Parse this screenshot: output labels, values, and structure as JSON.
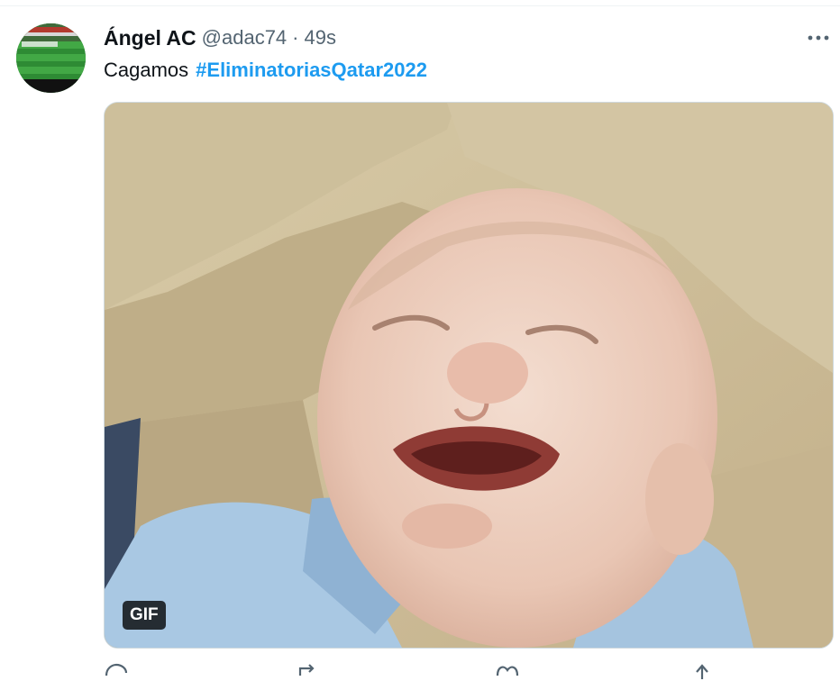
{
  "tweet": {
    "display_name": "Ángel AC",
    "handle": "@adac74",
    "separator": "·",
    "timestamp": "49s",
    "text": "Cagamos",
    "hashtag": "#EliminatoriasQatar2022"
  },
  "media": {
    "badge": "GIF",
    "description_icon": "crying-baby-gif"
  },
  "actions": [
    "reply-icon",
    "retweet-icon",
    "like-icon",
    "share-icon"
  ],
  "colors": {
    "link": "#1d9bf0",
    "secondary_text": "#536471",
    "primary_text": "#0f1419",
    "divider": "#eff3f4"
  }
}
